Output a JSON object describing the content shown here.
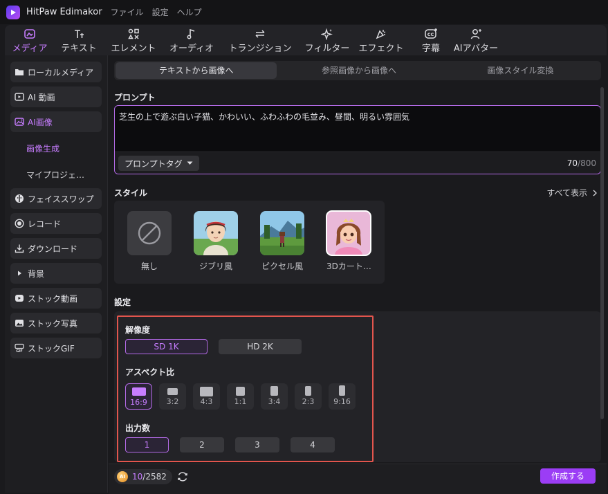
{
  "titlebar": {
    "app_name": "HitPaw Edimakor",
    "menu": [
      "ファイル",
      "設定",
      "ヘルプ"
    ]
  },
  "toolbar": {
    "tools": [
      {
        "label": "メディア",
        "icon": "media-icon",
        "active": true
      },
      {
        "label": "テキスト",
        "icon": "text-icon"
      },
      {
        "label": "エレメント",
        "icon": "element-icon"
      },
      {
        "label": "オーディオ",
        "icon": "audio-icon"
      },
      {
        "label": "トランジション",
        "icon": "transition-icon"
      },
      {
        "label": "フィルター",
        "icon": "filter-icon"
      },
      {
        "label": "エフェクト",
        "icon": "effect-icon"
      },
      {
        "label": "字幕",
        "icon": "subtitle-icon"
      },
      {
        "label": "AIアバター",
        "icon": "avatar-icon"
      }
    ]
  },
  "sidebar": {
    "items": [
      {
        "label": "ローカルメディア",
        "icon": "folder-icon"
      },
      {
        "label": "AI 動画",
        "icon": "ai-video-icon"
      },
      {
        "label": "AI画像",
        "icon": "ai-image-icon",
        "active": true
      },
      {
        "label": "フェイススワップ",
        "icon": "face-swap-icon"
      },
      {
        "label": "レコード",
        "icon": "record-icon"
      },
      {
        "label": "ダウンロード",
        "icon": "download-icon"
      },
      {
        "label": "背景",
        "icon": "caret-right-icon"
      },
      {
        "label": "ストック動画",
        "icon": "stock-video-icon"
      },
      {
        "label": "ストック写真",
        "icon": "stock-photo-icon"
      },
      {
        "label": "ストックGIF",
        "icon": "gif-icon"
      }
    ],
    "subitems": [
      {
        "label": "画像生成",
        "active": true
      },
      {
        "label": "マイプロジェ…"
      }
    ]
  },
  "tabs": [
    "テキストから画像へ",
    "参照画像から画像へ",
    "画像スタイル変換"
  ],
  "prompt": {
    "title": "プロンプト",
    "text": "芝生の上で遊ぶ白い子猫、かわいい、ふわふわの毛並み、昼間、明るい雰囲気",
    "tag_button": "プロンプトタグ",
    "count": "70",
    "max": "/800"
  },
  "style": {
    "title": "スタイル",
    "show_all": "すべて表示",
    "items": [
      {
        "label": "無し"
      },
      {
        "label": "ジブリ風"
      },
      {
        "label": "ピクセル風"
      },
      {
        "label": "3Dカート…",
        "selected": true
      }
    ]
  },
  "settings": {
    "title": "設定",
    "resolution_label": "解像度",
    "resolutions": [
      "SD 1K",
      "HD 2K"
    ],
    "resolution_selected": "SD 1K",
    "aspect_label": "アスペクト比",
    "aspects": [
      "16:9",
      "3:2",
      "4:3",
      "1:1",
      "3:4",
      "2:3",
      "9:16"
    ],
    "aspect_selected": "16:9",
    "output_label": "出力数",
    "outputs": [
      "1",
      "2",
      "3",
      "4"
    ],
    "output_selected": "1"
  },
  "footer": {
    "coin_label": "AI",
    "credits_used": "10",
    "credits_total": "/2582",
    "create_button": "作成する"
  },
  "colors": {
    "accent": "#c77dff",
    "accent_border": "#b36ae6",
    "create_button": "#9b3df5",
    "highlight_box": "#e2554d"
  }
}
